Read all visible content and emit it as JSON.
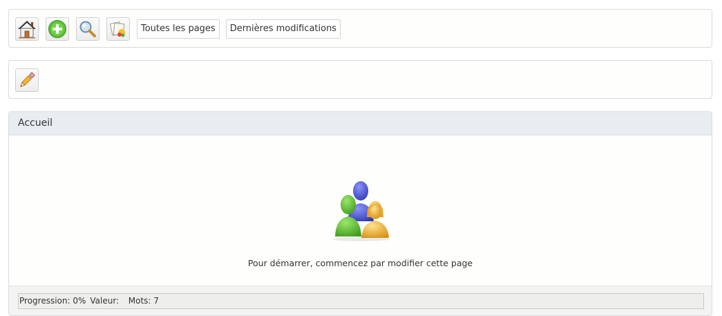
{
  "toolbar": {
    "icons": [
      {
        "name": "home-icon"
      },
      {
        "name": "add-icon"
      },
      {
        "name": "search-icon"
      },
      {
        "name": "pages-icon"
      }
    ],
    "all_pages_label": "Toutes les pages",
    "recent_changes_label": "Dernières modifications"
  },
  "edit_toolbar": {
    "icons": [
      {
        "name": "pencil-icon"
      }
    ]
  },
  "page": {
    "title": "Accueil",
    "illustration": "people-icon",
    "hint": "Pour démarrer, commencez par modifier cette page"
  },
  "status": {
    "progress": "Progression: 0%",
    "value": "Valeur:",
    "words": "Mots: 7"
  },
  "colors": {
    "header_bg": "#e8edf1",
    "green_person": "#5cb82c",
    "blue_person": "#4c55d6",
    "yellow_person": "#f1b531"
  }
}
